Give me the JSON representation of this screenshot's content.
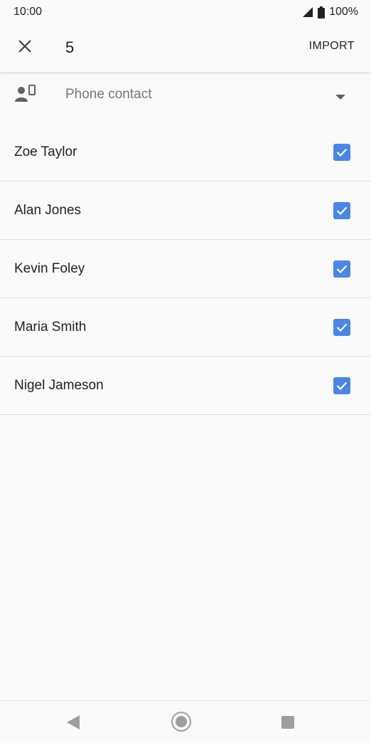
{
  "status_bar": {
    "time": "10:00",
    "battery": "100%",
    "icons": [
      "signal-icon",
      "battery-icon"
    ]
  },
  "app_bar": {
    "close_icon": "close-icon",
    "selected_count": "5",
    "import_label": "IMPORT"
  },
  "account": {
    "icon": "phone-contact-icon",
    "label": "Phone contact",
    "dropdown_icon": "dropdown-arrow-icon"
  },
  "contacts": [
    {
      "name": "Zoe Taylor",
      "checked": true
    },
    {
      "name": "Alan Jones",
      "checked": true
    },
    {
      "name": "Kevin Foley",
      "checked": true
    },
    {
      "name": "Maria Smith",
      "checked": true
    },
    {
      "name": "Nigel Jameson",
      "checked": true
    }
  ],
  "nav_bar": {
    "icons": [
      "back-icon",
      "home-icon",
      "recents-icon"
    ]
  },
  "colors": {
    "accent": "#4a86e8",
    "background": "#fafafa",
    "divider": "#dcdcdc",
    "secondary_text": "#757575"
  }
}
